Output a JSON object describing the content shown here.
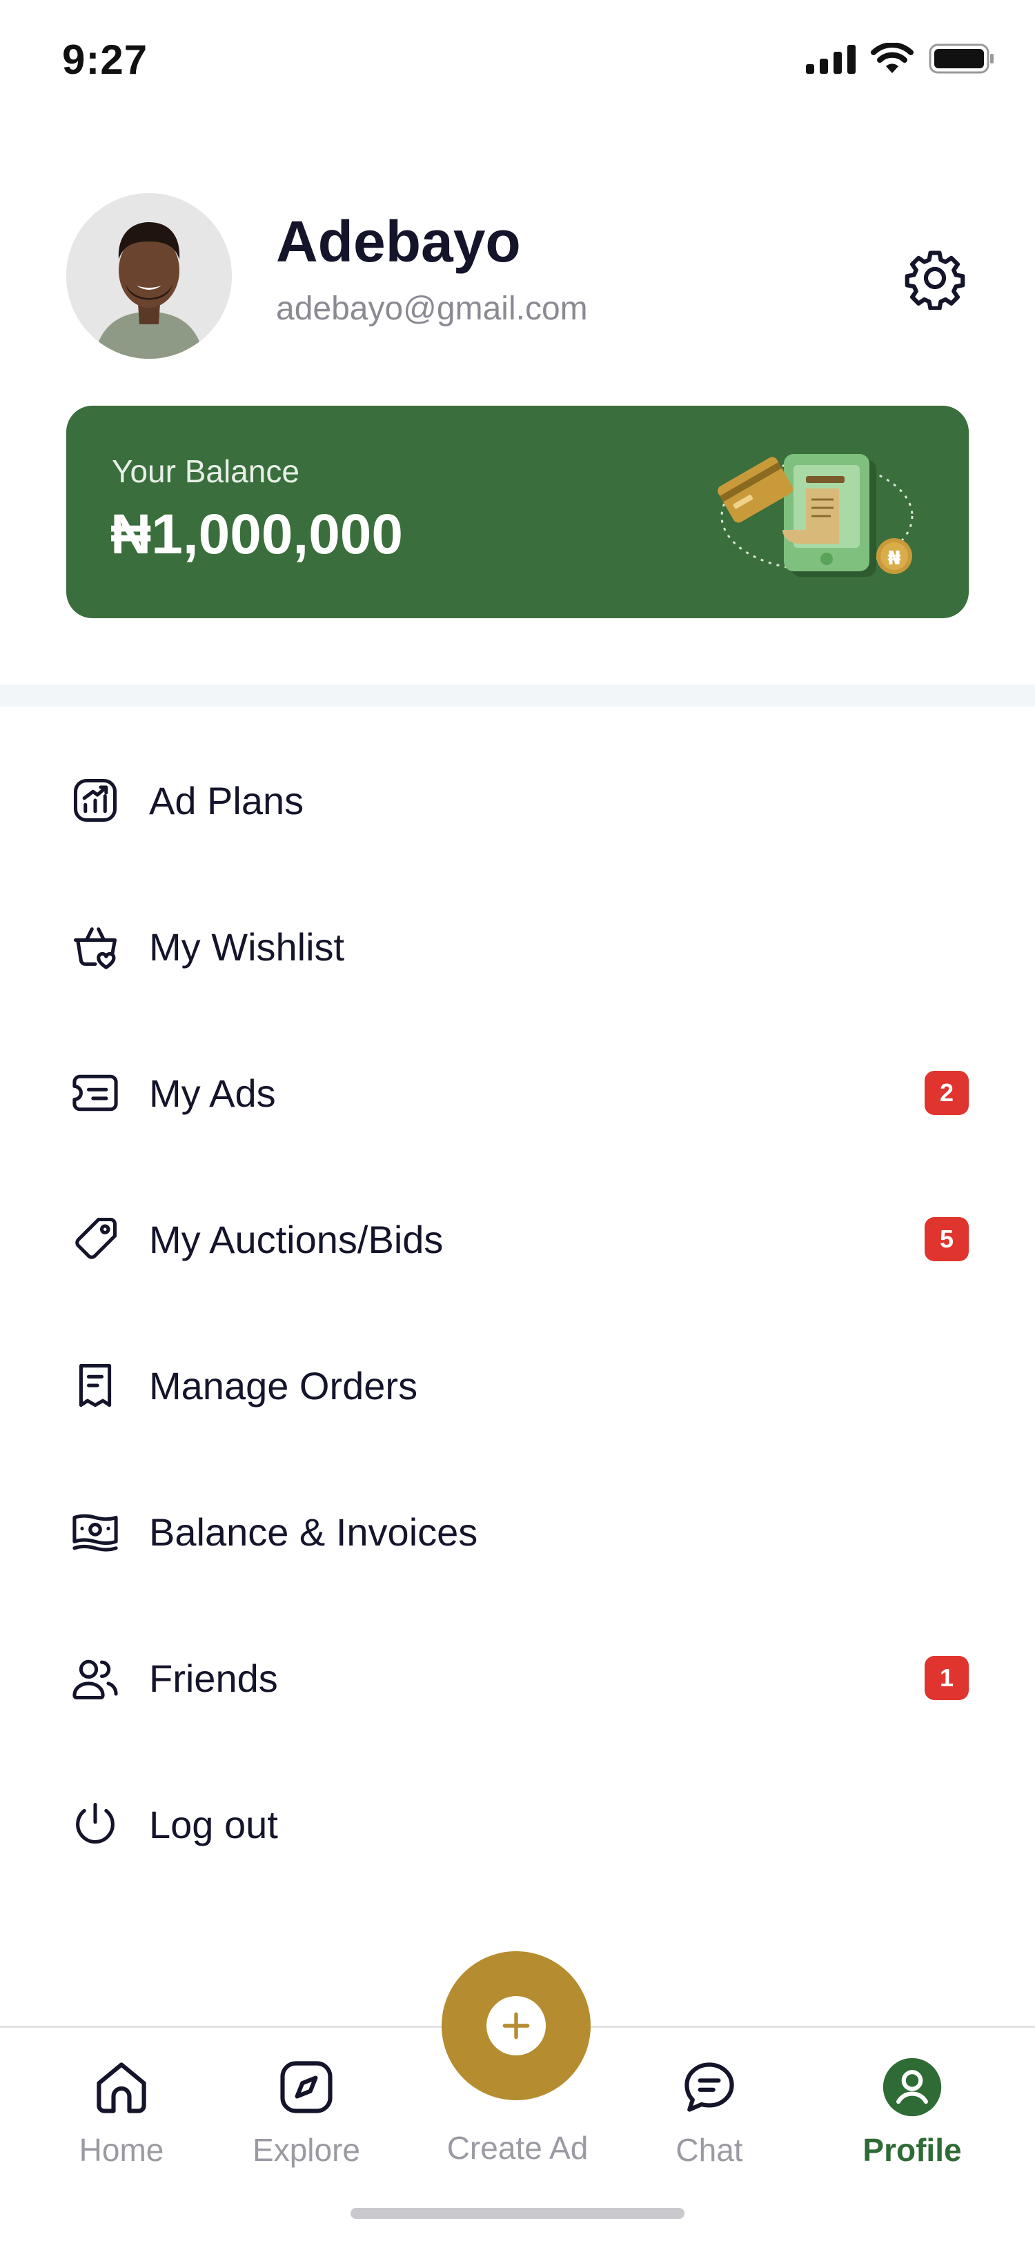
{
  "status_bar": {
    "time": "9:27",
    "icons": [
      "cellular-signal-icon",
      "wifi-icon",
      "battery-icon"
    ]
  },
  "profile": {
    "name": "Adebayo",
    "email": "adebayo@gmail.com",
    "settings_icon": "gear-icon"
  },
  "balance": {
    "label": "Your Balance",
    "amount": "₦1,000,000",
    "illustration": "wallet-payment-illustration"
  },
  "menu": {
    "items": [
      {
        "label": "Ad Plans",
        "icon": "chart-growth-icon",
        "badge": null
      },
      {
        "label": "My Wishlist",
        "icon": "basket-heart-icon",
        "badge": null
      },
      {
        "label": "My Ads",
        "icon": "ticket-icon",
        "badge": "2"
      },
      {
        "label": "My Auctions/Bids",
        "icon": "tag-icon",
        "badge": "5"
      },
      {
        "label": "Manage Orders",
        "icon": "receipt-icon",
        "badge": null
      },
      {
        "label": "Balance & Invoices",
        "icon": "money-icon",
        "badge": null
      },
      {
        "label": "Friends",
        "icon": "users-icon",
        "badge": "1"
      },
      {
        "label": "Log out",
        "icon": "power-icon",
        "badge": null
      }
    ]
  },
  "bottom_nav": {
    "items": [
      {
        "label": "Home",
        "icon": "home-icon",
        "active": false
      },
      {
        "label": "Explore",
        "icon": "compass-icon",
        "active": false
      },
      {
        "label": "Create Ad",
        "icon": "plus-icon",
        "active": false
      },
      {
        "label": "Chat",
        "icon": "chat-bubble-icon",
        "active": false
      },
      {
        "label": "Profile",
        "icon": "profile-icon",
        "active": true
      }
    ]
  },
  "colors": {
    "brand_green": "#3a6e3c",
    "accent_gold": "#b58c30",
    "badge_red": "#e0342f",
    "text_dark": "#14142b",
    "text_muted": "#8a8a93"
  }
}
